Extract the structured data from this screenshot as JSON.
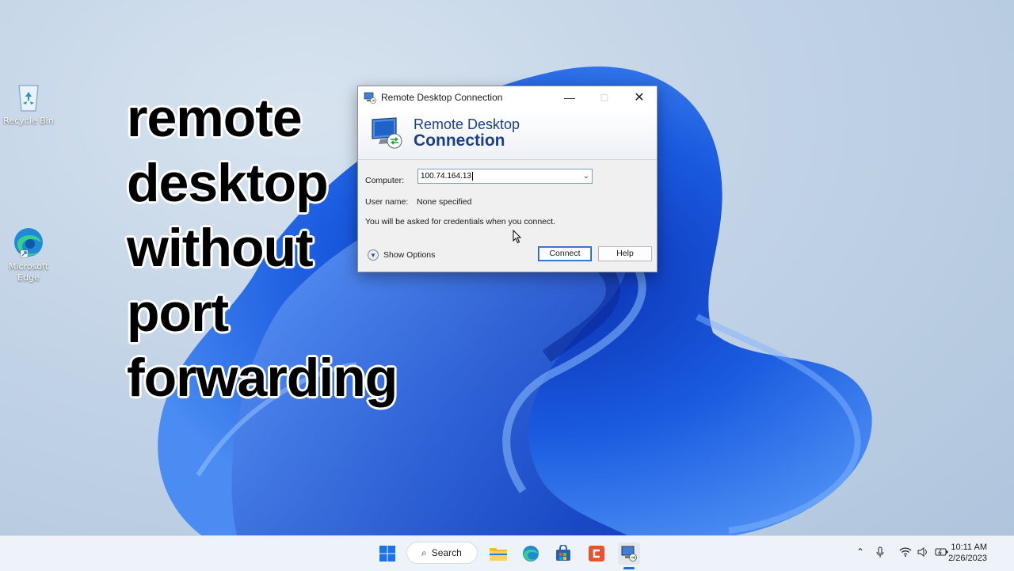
{
  "desktop": {
    "icons": [
      {
        "label": "Recycle Bin",
        "icon": "recycle-bin-icon"
      },
      {
        "label": "Microsoft Edge",
        "icon": "edge-icon"
      }
    ]
  },
  "overlay": {
    "lines": [
      "remote",
      "desktop",
      "without",
      "port",
      "forwarding"
    ]
  },
  "rdp": {
    "window_title": "Remote Desktop Connection",
    "banner_line1": "Remote Desktop",
    "banner_line2": "Connection",
    "computer_label": "Computer:",
    "computer_value": "100.74.164.13",
    "username_label": "User name:",
    "username_value": "None specified",
    "credentials_note": "You will be asked for credentials when you connect.",
    "show_options": "Show Options",
    "connect_label": "Connect",
    "help_label": "Help"
  },
  "taskbar": {
    "search_label": "Search",
    "time": "10:11 AM",
    "date": "2/26/2023",
    "apps": [
      "start-icon",
      "search-icon",
      "file-explorer-icon",
      "edge-icon",
      "store-icon",
      "snagit-icon",
      "remote-desktop-icon"
    ],
    "tray": [
      "chevron-up-icon",
      "microphone-icon",
      "wifi-icon",
      "volume-icon",
      "battery-icon"
    ]
  },
  "colors": {
    "accent": "#1e6fd9",
    "banner_text": "#1c3f8c",
    "wallpaper_blue": "#1a5be0"
  }
}
